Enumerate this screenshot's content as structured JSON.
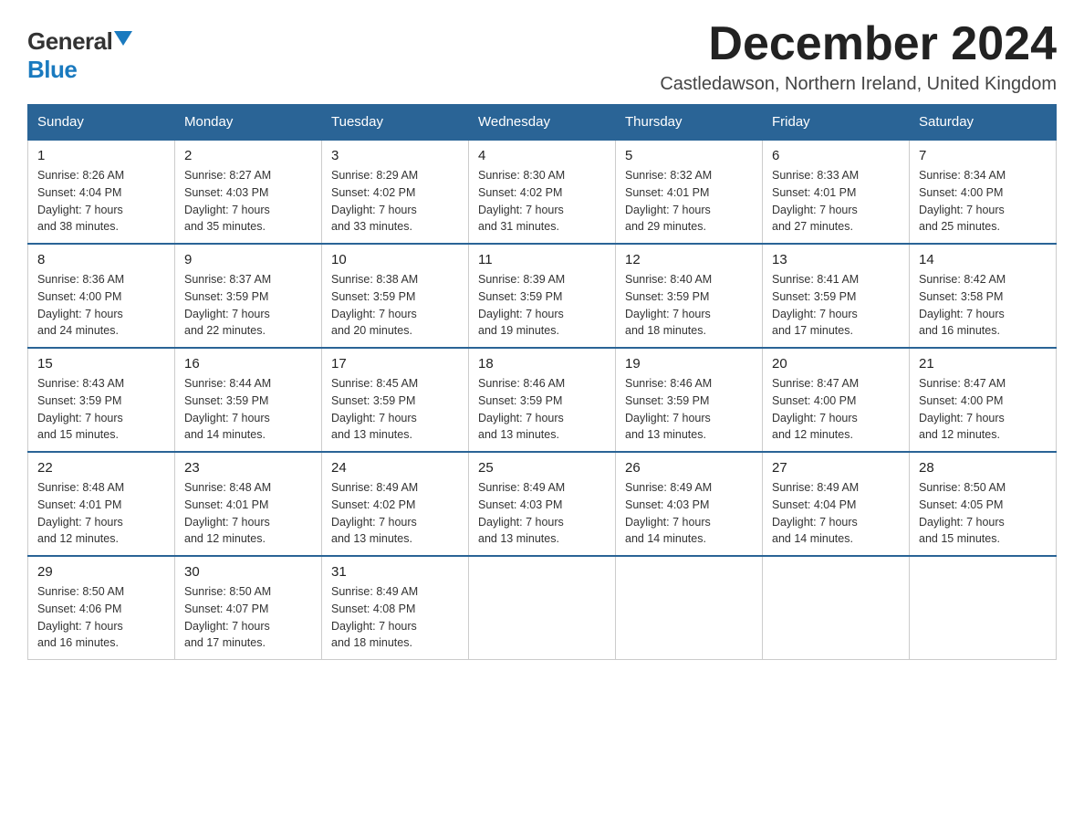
{
  "logo": {
    "general": "General",
    "blue": "Blue"
  },
  "title": "December 2024",
  "location": "Castledawson, Northern Ireland, United Kingdom",
  "days_of_week": [
    "Sunday",
    "Monday",
    "Tuesday",
    "Wednesday",
    "Thursday",
    "Friday",
    "Saturday"
  ],
  "weeks": [
    [
      {
        "day": "1",
        "sunrise": "8:26 AM",
        "sunset": "4:04 PM",
        "daylight": "7 hours and 38 minutes."
      },
      {
        "day": "2",
        "sunrise": "8:27 AM",
        "sunset": "4:03 PM",
        "daylight": "7 hours and 35 minutes."
      },
      {
        "day": "3",
        "sunrise": "8:29 AM",
        "sunset": "4:02 PM",
        "daylight": "7 hours and 33 minutes."
      },
      {
        "day": "4",
        "sunrise": "8:30 AM",
        "sunset": "4:02 PM",
        "daylight": "7 hours and 31 minutes."
      },
      {
        "day": "5",
        "sunrise": "8:32 AM",
        "sunset": "4:01 PM",
        "daylight": "7 hours and 29 minutes."
      },
      {
        "day": "6",
        "sunrise": "8:33 AM",
        "sunset": "4:01 PM",
        "daylight": "7 hours and 27 minutes."
      },
      {
        "day": "7",
        "sunrise": "8:34 AM",
        "sunset": "4:00 PM",
        "daylight": "7 hours and 25 minutes."
      }
    ],
    [
      {
        "day": "8",
        "sunrise": "8:36 AM",
        "sunset": "4:00 PM",
        "daylight": "7 hours and 24 minutes."
      },
      {
        "day": "9",
        "sunrise": "8:37 AM",
        "sunset": "3:59 PM",
        "daylight": "7 hours and 22 minutes."
      },
      {
        "day": "10",
        "sunrise": "8:38 AM",
        "sunset": "3:59 PM",
        "daylight": "7 hours and 20 minutes."
      },
      {
        "day": "11",
        "sunrise": "8:39 AM",
        "sunset": "3:59 PM",
        "daylight": "7 hours and 19 minutes."
      },
      {
        "day": "12",
        "sunrise": "8:40 AM",
        "sunset": "3:59 PM",
        "daylight": "7 hours and 18 minutes."
      },
      {
        "day": "13",
        "sunrise": "8:41 AM",
        "sunset": "3:59 PM",
        "daylight": "7 hours and 17 minutes."
      },
      {
        "day": "14",
        "sunrise": "8:42 AM",
        "sunset": "3:58 PM",
        "daylight": "7 hours and 16 minutes."
      }
    ],
    [
      {
        "day": "15",
        "sunrise": "8:43 AM",
        "sunset": "3:59 PM",
        "daylight": "7 hours and 15 minutes."
      },
      {
        "day": "16",
        "sunrise": "8:44 AM",
        "sunset": "3:59 PM",
        "daylight": "7 hours and 14 minutes."
      },
      {
        "day": "17",
        "sunrise": "8:45 AM",
        "sunset": "3:59 PM",
        "daylight": "7 hours and 13 minutes."
      },
      {
        "day": "18",
        "sunrise": "8:46 AM",
        "sunset": "3:59 PM",
        "daylight": "7 hours and 13 minutes."
      },
      {
        "day": "19",
        "sunrise": "8:46 AM",
        "sunset": "3:59 PM",
        "daylight": "7 hours and 13 minutes."
      },
      {
        "day": "20",
        "sunrise": "8:47 AM",
        "sunset": "4:00 PM",
        "daylight": "7 hours and 12 minutes."
      },
      {
        "day": "21",
        "sunrise": "8:47 AM",
        "sunset": "4:00 PM",
        "daylight": "7 hours and 12 minutes."
      }
    ],
    [
      {
        "day": "22",
        "sunrise": "8:48 AM",
        "sunset": "4:01 PM",
        "daylight": "7 hours and 12 minutes."
      },
      {
        "day": "23",
        "sunrise": "8:48 AM",
        "sunset": "4:01 PM",
        "daylight": "7 hours and 12 minutes."
      },
      {
        "day": "24",
        "sunrise": "8:49 AM",
        "sunset": "4:02 PM",
        "daylight": "7 hours and 13 minutes."
      },
      {
        "day": "25",
        "sunrise": "8:49 AM",
        "sunset": "4:03 PM",
        "daylight": "7 hours and 13 minutes."
      },
      {
        "day": "26",
        "sunrise": "8:49 AM",
        "sunset": "4:03 PM",
        "daylight": "7 hours and 14 minutes."
      },
      {
        "day": "27",
        "sunrise": "8:49 AM",
        "sunset": "4:04 PM",
        "daylight": "7 hours and 14 minutes."
      },
      {
        "day": "28",
        "sunrise": "8:50 AM",
        "sunset": "4:05 PM",
        "daylight": "7 hours and 15 minutes."
      }
    ],
    [
      {
        "day": "29",
        "sunrise": "8:50 AM",
        "sunset": "4:06 PM",
        "daylight": "7 hours and 16 minutes."
      },
      {
        "day": "30",
        "sunrise": "8:50 AM",
        "sunset": "4:07 PM",
        "daylight": "7 hours and 17 minutes."
      },
      {
        "day": "31",
        "sunrise": "8:49 AM",
        "sunset": "4:08 PM",
        "daylight": "7 hours and 18 minutes."
      },
      null,
      null,
      null,
      null
    ]
  ],
  "labels": {
    "sunrise": "Sunrise:",
    "sunset": "Sunset:",
    "daylight": "Daylight:"
  }
}
